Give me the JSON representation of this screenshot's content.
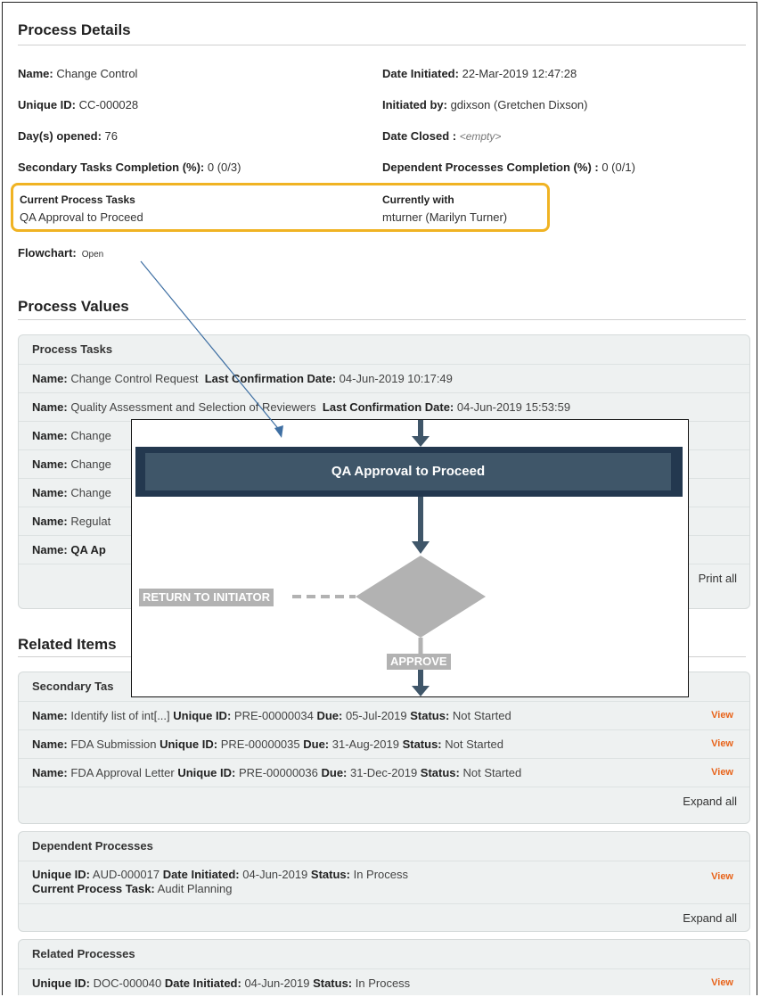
{
  "details": {
    "title": "Process Details",
    "name_label": "Name:",
    "name_value": "Change Control",
    "uid_label": "Unique ID:",
    "uid_value": "CC-000028",
    "days_label": "Day(s) opened:",
    "days_value": "76",
    "secondary_label": "Secondary Tasks Completion (%):",
    "secondary_value": "0 (0/3)",
    "date_init_label": "Date Initiated:",
    "date_init_value": "22-Mar-2019 12:47:28",
    "init_by_label": "Initiated by:",
    "init_by_value": "gdixson (Gretchen Dixson)",
    "date_closed_label": "Date Closed :",
    "date_closed_value": "<empty>",
    "dependent_label": "Dependent Processes Completion (%) :",
    "dependent_value": "0 (0/1)",
    "current_tasks_label": "Current Process Tasks",
    "current_tasks_value": "QA Approval to Proceed",
    "currently_with_label": "Currently with",
    "currently_with_value": "mturner (Marilyn Turner)",
    "flowchart_label": "Flowchart:",
    "flowchart_link": "Open"
  },
  "values": {
    "title": "Process Values",
    "tasks_header": "Process Tasks",
    "name_label": "Name:",
    "last_conf_label": "Last Confirmation Date:",
    "task1_name": "Change Control Request",
    "task1_date": "04-Jun-2019 10:17:49",
    "task2_name": "Quality Assessment and Selection of Reviewers",
    "task2_date": "04-Jun-2019 15:53:59",
    "task3_name": "Change",
    "task4_name": "Change",
    "task5_name": "Change",
    "task6_name": "Regulat",
    "task7_name": "QA Ap",
    "print_all": "Print all"
  },
  "related": {
    "title": "Related Items",
    "secondary_header": "Secondary Tas",
    "name_label": "Name:",
    "uid_label": "Unique ID:",
    "due_label": "Due:",
    "status_label": "Status:",
    "date_init_label": "Date Initiated:",
    "view": "View",
    "sec1_name": "Identify list of int[...]",
    "sec1_uid": "PRE-00000034",
    "sec1_due": "05-Jul-2019",
    "sec1_status": "Not Started",
    "sec2_name": "FDA Submission",
    "sec2_uid": "PRE-00000035",
    "sec2_due": "31-Aug-2019",
    "sec2_status": "Not Started",
    "sec3_name": "FDA Approval Letter",
    "sec3_uid": "PRE-00000036",
    "sec3_due": "31-Dec-2019",
    "sec3_status": "Not Started",
    "expand_all": "Expand all",
    "dependent_header": "Dependent Processes",
    "dep1_uid": "AUD-000017",
    "dep1_date": "04-Jun-2019",
    "dep1_status": "In Process",
    "current_task_label": "Current Process Task:",
    "dep1_task": "Audit Planning",
    "related_header": "Related Processes",
    "rel1_uid": "DOC-000040",
    "rel1_date": "04-Jun-2019",
    "rel1_status": "In Process"
  },
  "flowchart": {
    "step": "QA Approval to Proceed",
    "return_label": "RETURN TO INITIATOR",
    "approve_label": "APPROVE",
    "box_color": "#3f5669",
    "border_color": "#23384f",
    "decision_color": "#b2b2b2"
  },
  "highlight_color": "#f0b323",
  "link_color": "#e8641b"
}
